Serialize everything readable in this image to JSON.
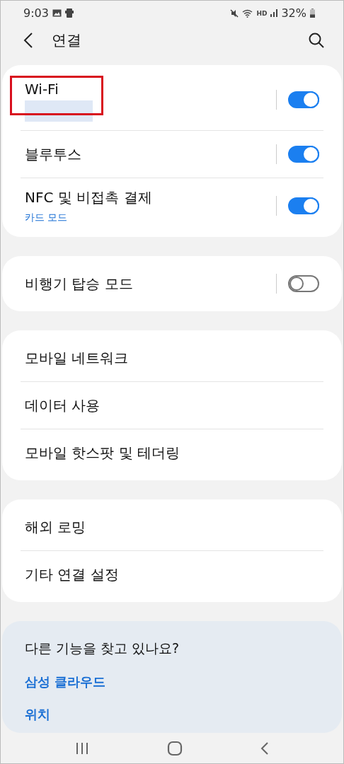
{
  "status_bar": {
    "time": "9:03",
    "hd_label": "HD",
    "battery": "32%"
  },
  "header": {
    "title": "연결"
  },
  "groups": [
    {
      "items": [
        {
          "kind": "toggle",
          "label": "Wi-Fi",
          "highlighted": true,
          "redacted_sublabel": true,
          "on": true
        },
        {
          "kind": "toggle",
          "label": "블루투스",
          "on": true
        },
        {
          "kind": "toggle",
          "label": "NFC 및 비접촉 결제",
          "sublabel": "카드 모드",
          "on": true
        }
      ]
    },
    {
      "items": [
        {
          "kind": "toggle",
          "label": "비행기 탑승 모드",
          "on": false
        }
      ]
    },
    {
      "items": [
        {
          "kind": "link",
          "label": "모바일 네트워크"
        },
        {
          "kind": "link",
          "label": "데이터 사용"
        },
        {
          "kind": "link",
          "label": "모바일 핫스팟 및 테더링"
        }
      ]
    },
    {
      "items": [
        {
          "kind": "link",
          "label": "해외 로밍"
        },
        {
          "kind": "link",
          "label": "기타 연결 설정"
        }
      ]
    }
  ],
  "suggestions": {
    "title": "다른 기능을 찾고 있나요?",
    "links": [
      "삼성 클라우드",
      "위치"
    ]
  }
}
